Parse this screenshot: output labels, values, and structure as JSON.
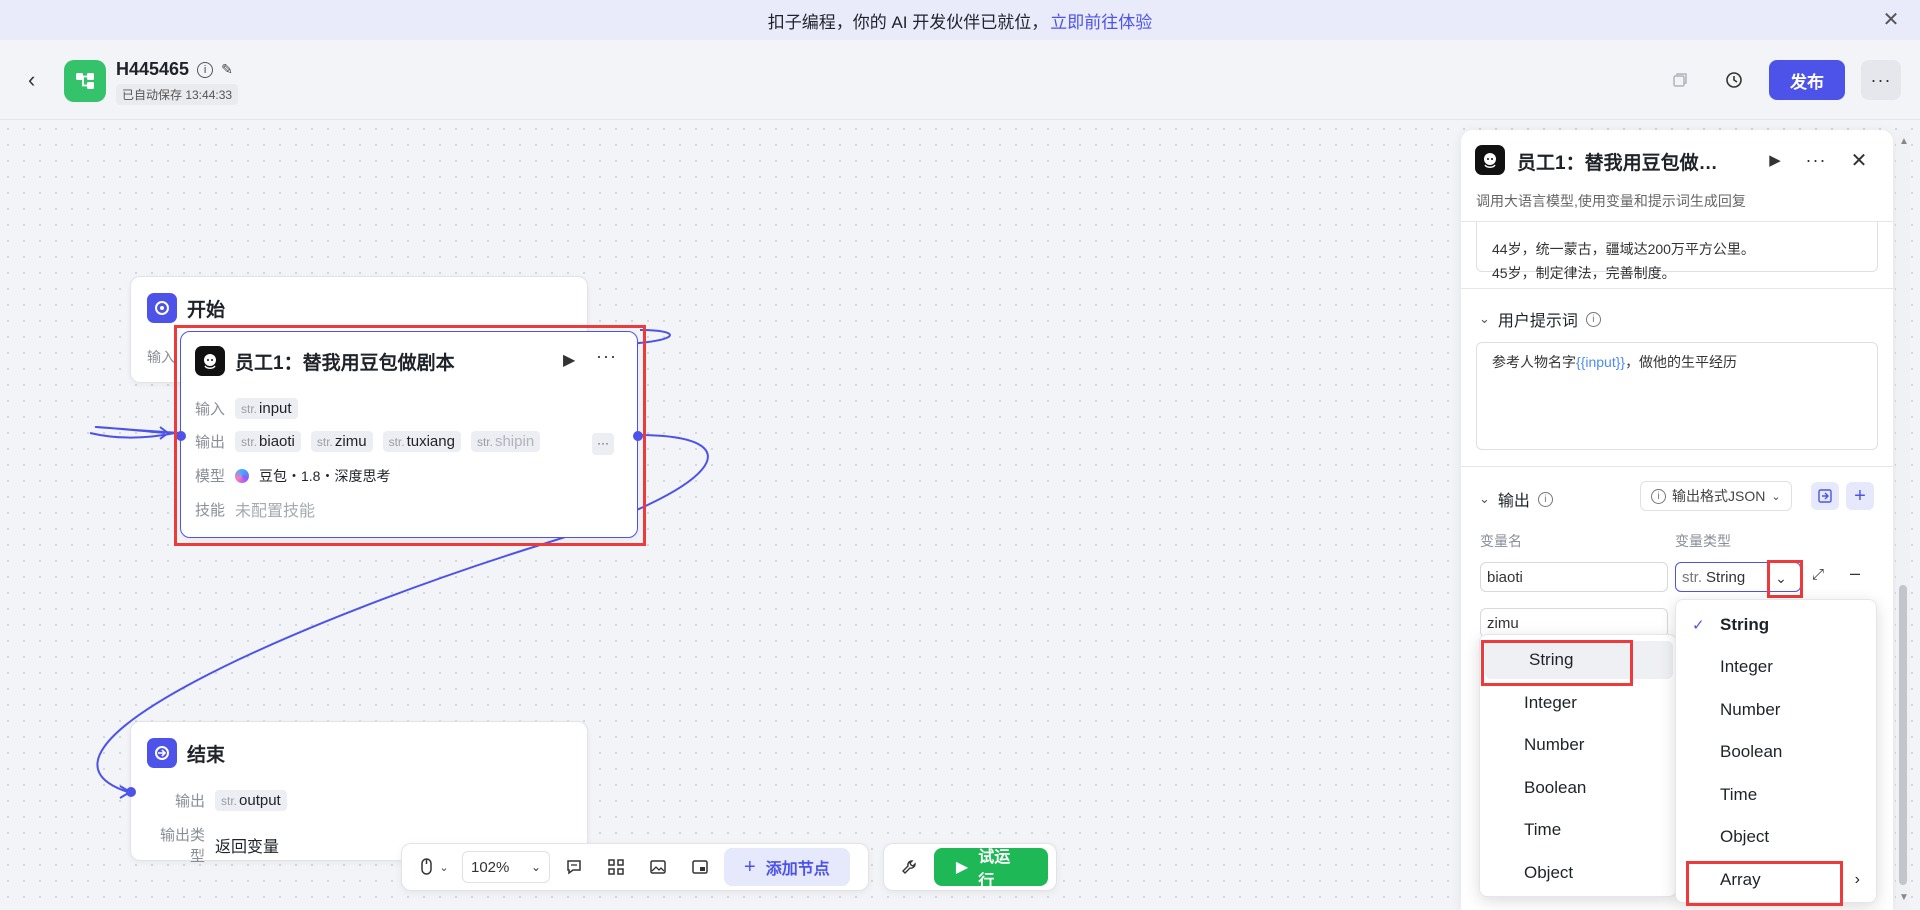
{
  "banner": {
    "text": "扣子编程，你的 AI 开发伙伴已就位，",
    "link": "立即前往体验",
    "close_icon": "close-icon"
  },
  "header": {
    "title": "H445465",
    "autosave": "已自动保存 13:44:33",
    "publish_label": "发布"
  },
  "nodes": {
    "start": {
      "title": "开始",
      "input_label": "输入"
    },
    "llm": {
      "title": "员工1：替我用豆包做剧本",
      "input_label": "输入",
      "input_tag": {
        "prefix": "str.",
        "name": "input"
      },
      "output_label": "输出",
      "output_tags": [
        {
          "prefix": "str.",
          "name": "biaoti"
        },
        {
          "prefix": "str.",
          "name": "zimu"
        },
        {
          "prefix": "str.",
          "name": "tuxiang"
        },
        {
          "prefix": "str.",
          "name": "shipin"
        }
      ],
      "model_label": "模型",
      "model_value": "豆包・1.8・深度思考",
      "skill_label": "技能",
      "skill_value": "未配置技能"
    },
    "end": {
      "title": "结束",
      "output_label": "输出",
      "output_tag": {
        "prefix": "str.",
        "name": "output"
      },
      "output_type_label": "输出类型",
      "output_type_value": "返回变量"
    }
  },
  "toolbar": {
    "zoom": "102%",
    "add_node_label": "添加节点",
    "run_label": "试运行"
  },
  "panel": {
    "title": "员工1：替我用豆包做…",
    "description": "调用大语言模型,使用变量和提示词生成回复",
    "system_prompt_tail": [
      "44岁，统一蒙古，疆域达200万平方公里。",
      "45岁，制定律法，完善制度。"
    ],
    "user_prompt_title": "用户提示词",
    "user_prompt_before": "参考人物名字",
    "user_prompt_var": "{{input}}",
    "user_prompt_after": "，做他的生平经历",
    "output_title": "输出",
    "output_format": "输出格式JSON",
    "var_name_header": "变量名",
    "var_type_header": "变量类型",
    "row1_name": "biaoti",
    "row1_type_prefix": "str.",
    "row1_type": "String",
    "row2_name": "zimu"
  },
  "dropdown_left": [
    "String",
    "Integer",
    "Number",
    "Boolean",
    "Time",
    "Object"
  ],
  "dropdown_right": [
    "String",
    "Integer",
    "Number",
    "Boolean",
    "Time",
    "Object",
    "Array"
  ],
  "colors": {
    "accent": "#4d53e8",
    "run": "#1fb857",
    "highlight": "#ee3a3a"
  }
}
